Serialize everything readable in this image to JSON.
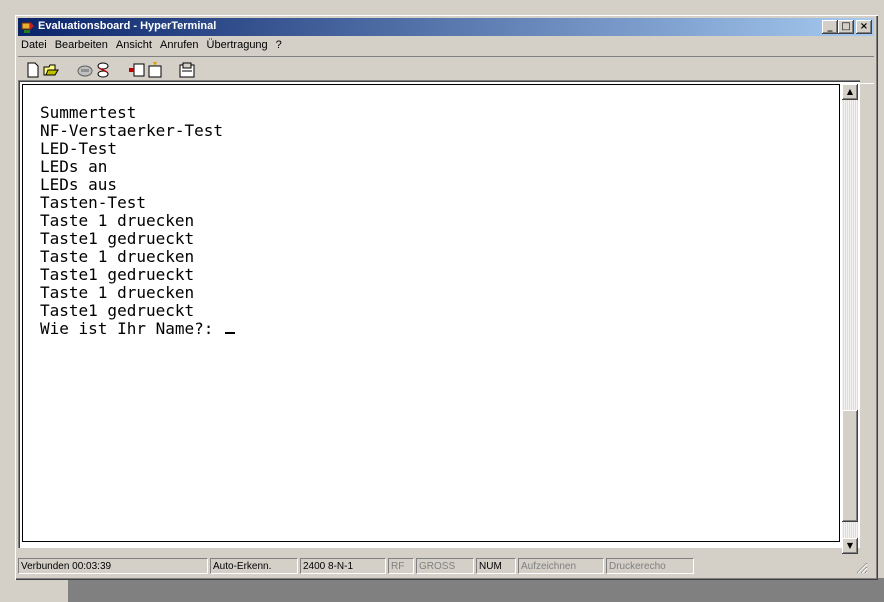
{
  "window": {
    "title": "Evaluationsboard - HyperTerminal",
    "controls": [
      "minimize",
      "maximize",
      "close"
    ]
  },
  "menu": [
    "Datei",
    "Bearbeiten",
    "Ansicht",
    "Anrufen",
    "Übertragung",
    "?"
  ],
  "toolbar": {
    "buttons": [
      "new-icon",
      "open-icon",
      "call-icon",
      "disconnect-icon",
      "send-icon",
      "receive-icon",
      "properties-icon"
    ]
  },
  "terminal": {
    "lines": [
      "Summertest",
      "NF-Verstaerker-Test",
      "LED-Test",
      "LEDs an",
      "LEDs aus",
      "Tasten-Test",
      "Taste 1 druecken",
      "Taste1 gedrueckt",
      "Taste 1 druecken",
      "Taste1 gedrueckt",
      "Taste 1 druecken",
      "Taste1 gedrueckt",
      "Wie ist Ihr Name?: "
    ]
  },
  "status": {
    "connection": "Verbunden 00:03:39",
    "detection": "Auto-Erkenn.",
    "settings": "2400 8-N-1",
    "rf": "RF",
    "caps": "GROSS",
    "num": "NUM",
    "capture": "Aufzeichnen",
    "print_echo": "Druckerecho"
  },
  "colors": {
    "titlebar_start": "#0a246a",
    "titlebar_end": "#a6caf0",
    "chrome": "#d4d0c8"
  }
}
